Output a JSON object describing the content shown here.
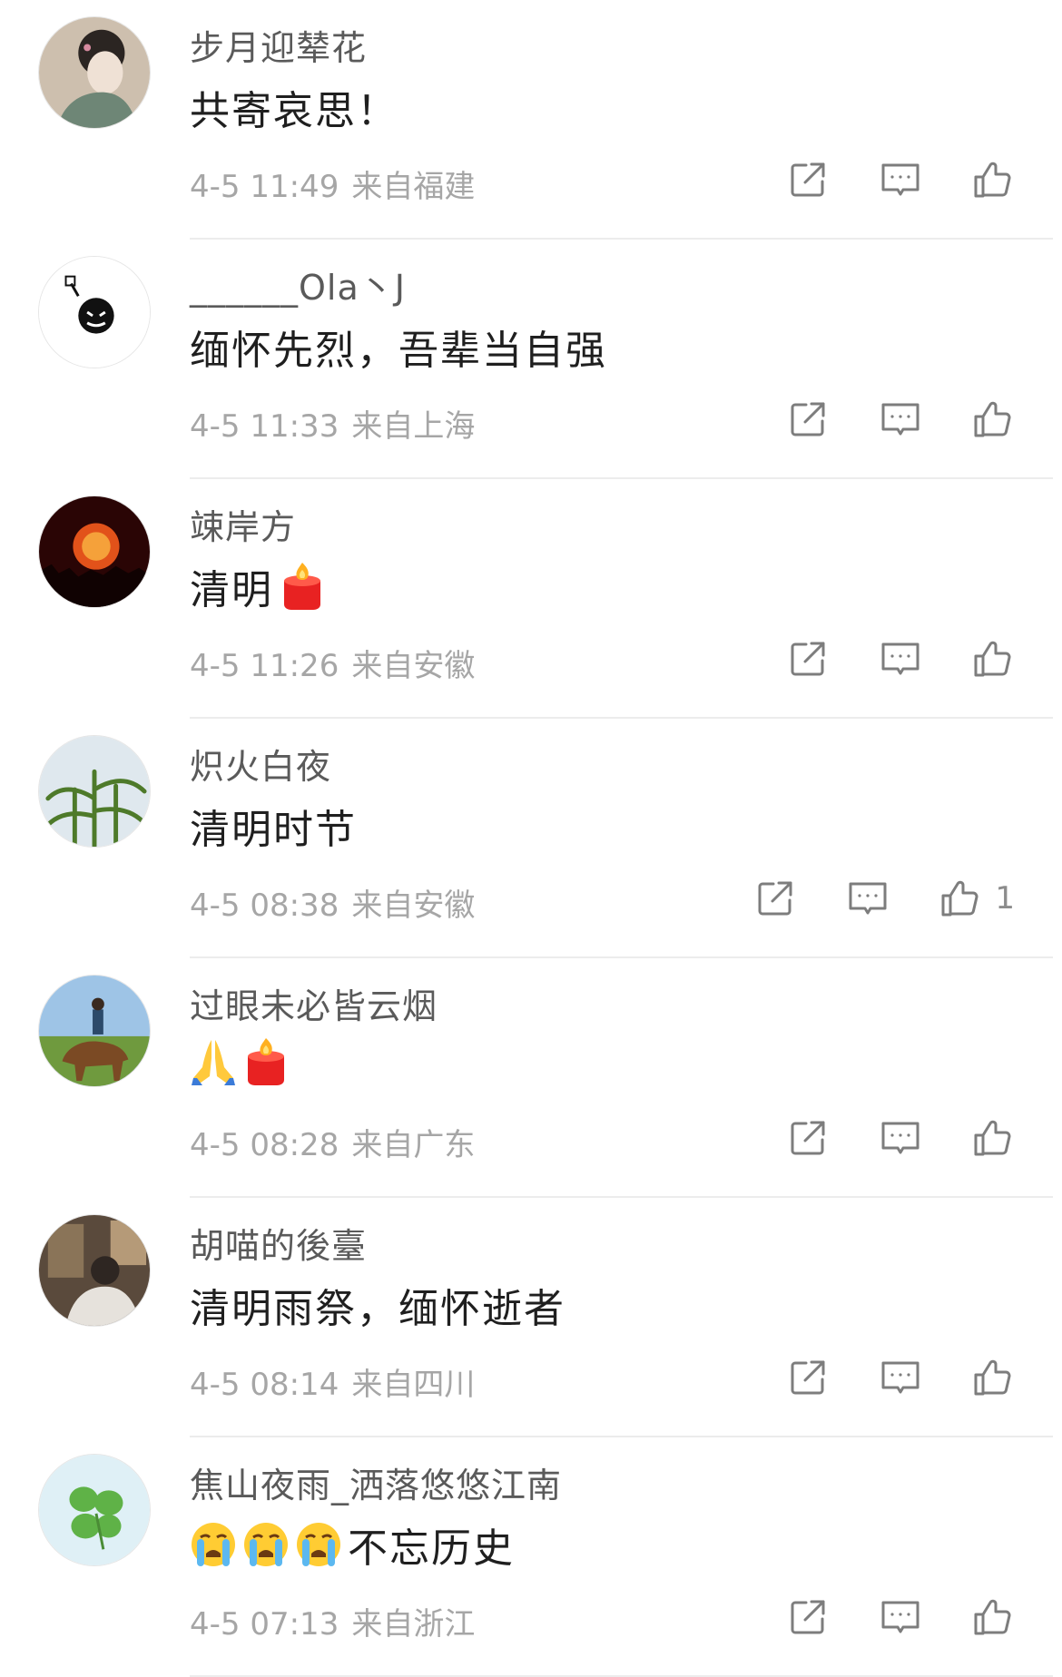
{
  "comments": [
    {
      "username": "步月迎辇花",
      "content": "共寄哀思！",
      "time": "4-5 11:49",
      "location": "来自福建",
      "likes": "",
      "emojis_after": [],
      "emojis_before": []
    },
    {
      "username": "______Ola丶J",
      "content": "缅怀先烈，吾辈当自强",
      "time": "4-5 11:33",
      "location": "来自上海",
      "likes": "",
      "emojis_after": [],
      "emojis_before": []
    },
    {
      "username": "竦岸方",
      "content": "清明",
      "time": "4-5 11:26",
      "location": "来自安徽",
      "likes": "",
      "emojis_after": [
        "candle"
      ],
      "emojis_before": []
    },
    {
      "username": "炽火白夜",
      "content": "清明时节",
      "time": "4-5 08:38",
      "location": "来自安徽",
      "likes": "1",
      "emojis_after": [],
      "emojis_before": []
    },
    {
      "username": "过眼未必皆云烟",
      "content": "",
      "time": "4-5 08:28",
      "location": "来自广东",
      "likes": "",
      "emojis_after": [
        "pray",
        "candle"
      ],
      "emojis_before": []
    },
    {
      "username": "胡喵的後臺",
      "content": "清明雨祭，缅怀逝者",
      "time": "4-5 08:14",
      "location": "来自四川",
      "likes": "",
      "emojis_after": [],
      "emojis_before": []
    },
    {
      "username": "焦山夜雨_洒落悠悠江南",
      "content": "不忘历史",
      "time": "4-5 07:13",
      "location": "来自浙江",
      "likes": "",
      "emojis_after": [],
      "emojis_before": [
        "crying-face",
        "crying-face",
        "crying-face"
      ]
    }
  ],
  "icons": {
    "share": "share-icon",
    "comment": "comment-icon",
    "like": "thumbs-up-icon"
  },
  "colors": {
    "username": "#5a5a5a",
    "meta": "#a6a6a6",
    "icon": "#7d7d7d",
    "divider": "#ececec"
  }
}
